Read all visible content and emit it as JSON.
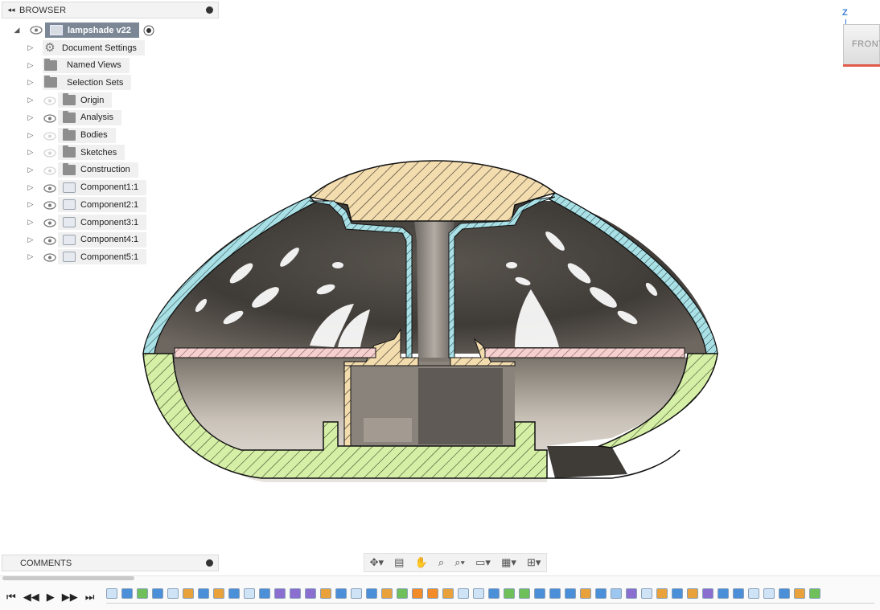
{
  "browser": {
    "title": "BROWSER",
    "root": {
      "label": "lampshade v22"
    },
    "items": [
      {
        "label": "Document Settings",
        "icon": "gear-icon",
        "eye": "none"
      },
      {
        "label": "Named Views",
        "icon": "folder-icon",
        "eye": "none"
      },
      {
        "label": "Selection Sets",
        "icon": "folder-icon",
        "eye": "none"
      },
      {
        "label": "Origin",
        "icon": "folder-icon",
        "eye": "hidden"
      },
      {
        "label": "Analysis",
        "icon": "folder-icon",
        "eye": "visible"
      },
      {
        "label": "Bodies",
        "icon": "folder-icon",
        "eye": "hidden"
      },
      {
        "label": "Sketches",
        "icon": "folder-icon",
        "eye": "hidden"
      },
      {
        "label": "Construction",
        "icon": "folder-icon",
        "eye": "hidden"
      },
      {
        "label": "Component1:1",
        "icon": "component-icon",
        "eye": "visible"
      },
      {
        "label": "Component2:1",
        "icon": "component-icon",
        "eye": "visible"
      },
      {
        "label": "Component3:1",
        "icon": "component-icon",
        "eye": "visible"
      },
      {
        "label": "Component4:1",
        "icon": "component-icon",
        "eye": "visible"
      },
      {
        "label": "Component5:1",
        "icon": "component-icon",
        "eye": "visible"
      }
    ]
  },
  "viewcube": {
    "face": "FRONT",
    "axis": "Z"
  },
  "comments": {
    "title": "COMMENTS"
  },
  "nav_toolbar": {
    "tools": [
      "orbit-icon",
      "look-at-icon",
      "pan-icon",
      "zoom-icon",
      "zoom-window-icon",
      "display-settings-icon",
      "grid-settings-icon",
      "viewports-icon"
    ]
  },
  "timeline": {
    "controls": [
      "go-to-start-icon",
      "step-back-icon",
      "play-icon",
      "step-forward-icon",
      "go-to-end-icon"
    ],
    "feature_count": 47
  },
  "colors": {
    "cap_hatch": "#f3dcae",
    "shell_hatch": "#a8e0e6",
    "base_hatch": "#d6efa6",
    "plate_hatch": "#f6cfcf",
    "metal_dark": "#4a4744",
    "metal_light": "#b8b0a6"
  }
}
